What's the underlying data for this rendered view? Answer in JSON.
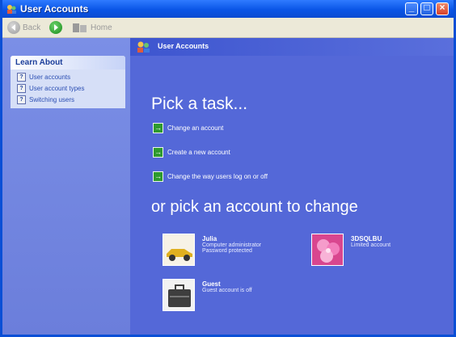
{
  "window": {
    "title": "User Accounts"
  },
  "toolbar": {
    "back_label": "Back",
    "home_label": "Home"
  },
  "sidebar": {
    "panel_title": "Learn About",
    "items": [
      {
        "label": "User accounts"
      },
      {
        "label": "User account types"
      },
      {
        "label": "Switching users"
      }
    ]
  },
  "content": {
    "header_title": "User Accounts",
    "heading": "Pick a task...",
    "tasks": [
      {
        "label": "Change an account"
      },
      {
        "label": "Create a new account"
      },
      {
        "label": "Change the way users log on or off"
      }
    ],
    "subheading": "or pick an account to change",
    "accounts": [
      {
        "name": "Julia",
        "line1": "Computer administrator",
        "line2": "Password protected",
        "picture": "car-icon"
      },
      {
        "name": "3DSQLBU",
        "line1": "Limited account",
        "line2": "",
        "picture": "flower-icon"
      },
      {
        "name": "Guest",
        "line1": "Guest account is off",
        "line2": "",
        "picture": "briefcase-icon"
      }
    ]
  }
}
